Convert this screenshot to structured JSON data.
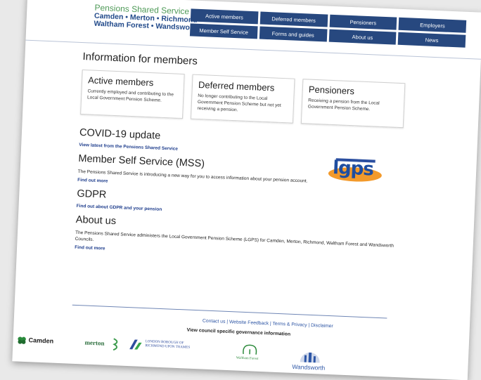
{
  "header": {
    "logo_line1": "Pensions Shared Service",
    "logo_line2": "Camden • Merton • Richmond",
    "logo_line3": "Waltham Forest • Wandsworth"
  },
  "nav": {
    "items": [
      "Active members",
      "Deferred members",
      "Pensioners",
      "Employers",
      "Member Self Service",
      "Forms and guides",
      "About us",
      "News"
    ]
  },
  "main": {
    "title": "Information for members",
    "cards": [
      {
        "title": "Active members",
        "desc": "Currently employed and contributing to the Local Government Pension Scheme."
      },
      {
        "title": "Deferred members",
        "desc": "No longer contributing to the Local Government Pension Scheme but not yet receiving a pension."
      },
      {
        "title": "Pensioners",
        "desc": "Receiving a pension from the Local Government Pension Scheme."
      }
    ],
    "covid": {
      "title": "COVID-19 update",
      "link": "View latest from the Pensions Shared Service"
    },
    "mss": {
      "title": "Member Self Service (MSS)",
      "text": "The Pensions Shared Service is introducing a new way for you to access information about your pension account.",
      "link": "Find out more"
    },
    "gdpr": {
      "title": "GDPR",
      "link": "Find out about GDPR and your pension"
    },
    "about": {
      "title": "About us",
      "text": "The Pensions Shared Service administers the Local Government Pension Scheme (LGPS) for Camden, Merton, Richmond, Waltham Forest and Wandsworth Councils.",
      "link": "Find out more"
    },
    "lgps_logo": "lgps"
  },
  "footer": {
    "links": "Contact us | Website Feedback | Terms & Privacy | Disclaimer",
    "governance": "View council specific governance information",
    "councils": {
      "camden": "Camden",
      "merton": "merton",
      "richmond": "LONDON BOROUGH OF RICHMOND UPON THAMES",
      "waltham": "Waltham Forest",
      "wandsworth": "Wandsworth"
    }
  },
  "colors": {
    "nav_bg": "#27487f",
    "brand_green": "#4f9a58",
    "link_blue": "#1f3e8d",
    "lgps_orange": "#f39a2b"
  }
}
